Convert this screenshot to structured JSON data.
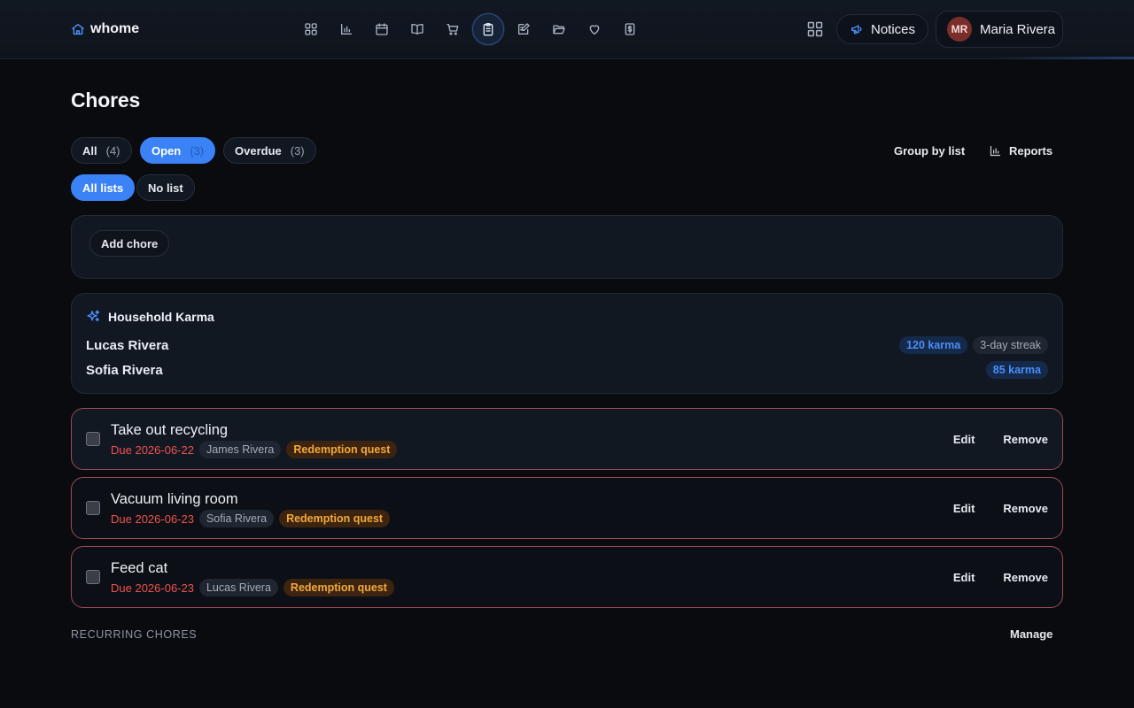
{
  "header": {
    "brand": "whome",
    "nav": [
      {
        "icon": "dashboard-icon"
      },
      {
        "icon": "bar-chart-icon"
      },
      {
        "icon": "calendar-icon"
      },
      {
        "icon": "book-icon"
      },
      {
        "icon": "cart-icon"
      },
      {
        "icon": "clipboard-icon",
        "active": true
      },
      {
        "icon": "edit-note-icon"
      },
      {
        "icon": "folder-icon"
      },
      {
        "icon": "heart-icon"
      },
      {
        "icon": "dollar-icon"
      }
    ],
    "notices_label": "Notices",
    "user": {
      "initials": "MR",
      "name": "Maria Rivera"
    }
  },
  "page": {
    "title": "Chores",
    "filters": [
      {
        "label": "All",
        "count": "(4)",
        "active": false
      },
      {
        "label": "Open",
        "count": "(3)",
        "active": true
      },
      {
        "label": "Overdue",
        "count": "(3)",
        "active": false
      }
    ],
    "list_filters": [
      {
        "label": "All lists",
        "active": true
      },
      {
        "label": "No list",
        "active": false
      }
    ],
    "group_by_label": "Group by list",
    "reports_label": "Reports",
    "add_chore_label": "Add chore"
  },
  "karma": {
    "title": "Household Karma",
    "members": [
      {
        "name": "Lucas Rivera",
        "karma": "120 karma",
        "streak": "3-day streak"
      },
      {
        "name": "Sofia Rivera",
        "karma": "85 karma",
        "streak": ""
      }
    ]
  },
  "chores": [
    {
      "title": "Take out recycling",
      "due": "Due 2026-06-22",
      "assignee": "James Rivera",
      "tag": "Redemption quest"
    },
    {
      "title": "Vacuum living room",
      "due": "Due 2026-06-23",
      "assignee": "Sofia Rivera",
      "tag": "Redemption quest"
    },
    {
      "title": "Feed cat",
      "due": "Due 2026-06-23",
      "assignee": "Lucas Rivera",
      "tag": "Redemption quest"
    }
  ],
  "chore_actions": {
    "edit": "Edit",
    "remove": "Remove"
  },
  "recurring": {
    "label": "RECURRING CHORES",
    "manage": "Manage"
  },
  "colors": {
    "accent": "#3b82f6",
    "overdue": "#f0524f",
    "quest": "#f2a93b",
    "background": "#090b0f"
  }
}
